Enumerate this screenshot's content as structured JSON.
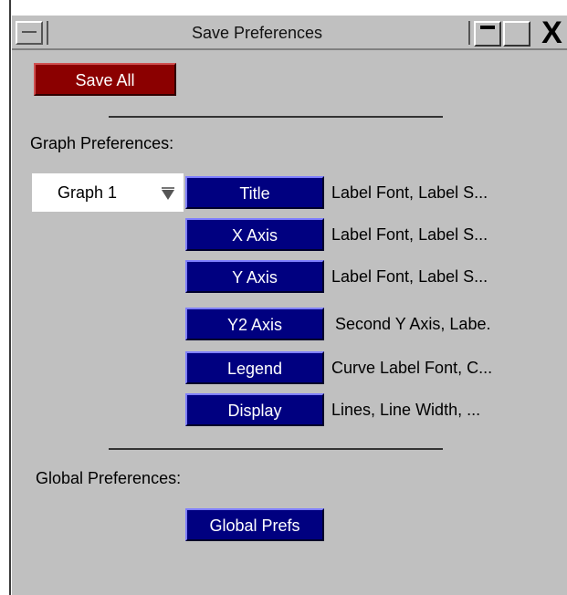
{
  "window": {
    "title": "Save Preferences",
    "close_glyph": "X",
    "icons": [
      "window-menu-icon",
      "minimize-icon",
      "maximize-icon",
      "close-icon"
    ]
  },
  "save_all": {
    "label": "Save All"
  },
  "graph_prefs": {
    "heading": "Graph Preferences:",
    "graph_select": {
      "value": "Graph 1"
    },
    "items": [
      {
        "label": "Title",
        "desc": "Label Font, Label S..."
      },
      {
        "label": "X Axis",
        "desc": "Label Font, Label S..."
      },
      {
        "label": "Y Axis",
        "desc": "Label Font, Label S..."
      },
      {
        "label": "Y2 Axis",
        "desc": "Second Y Axis, Labe."
      },
      {
        "label": "Legend",
        "desc": "Curve Label Font, C..."
      },
      {
        "label": "Display",
        "desc": "Lines, Line Width, ..."
      }
    ]
  },
  "global_prefs": {
    "heading": "Global Preferences:",
    "button_label": "Global Prefs"
  },
  "colors": {
    "panel_bg": "#c0c0c0",
    "save_button": "#8b0000",
    "pref_button": "#000080"
  }
}
